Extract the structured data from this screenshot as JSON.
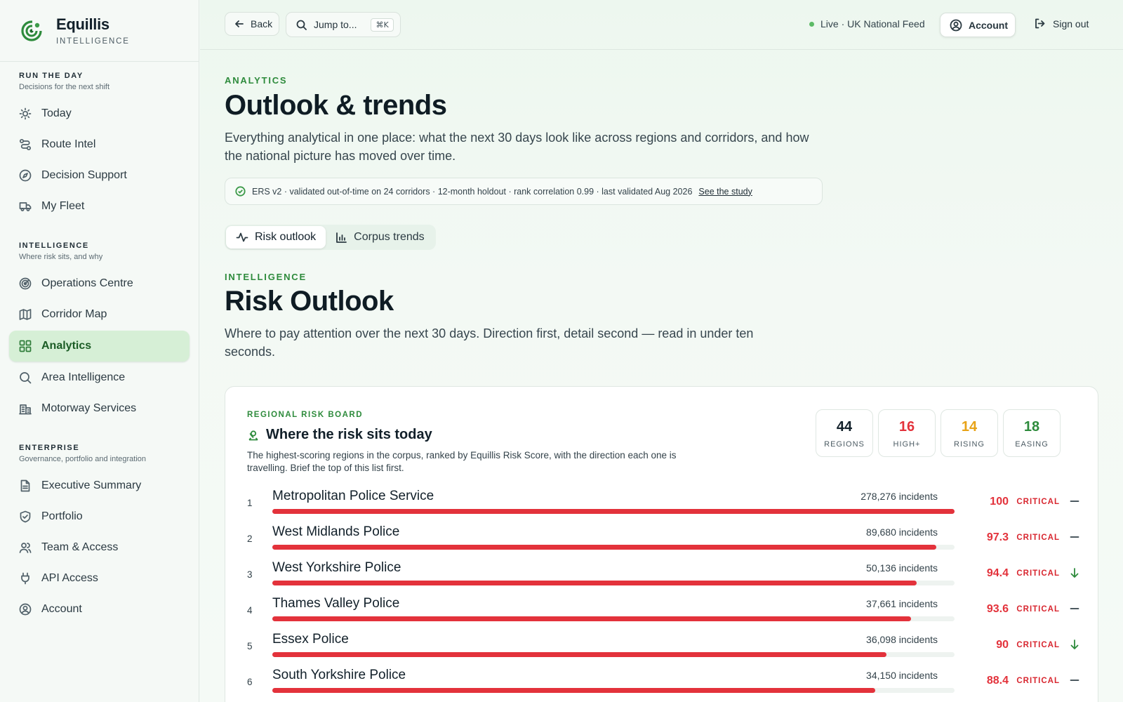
{
  "brand": {
    "name": "Equillis",
    "sub": "INTELLIGENCE"
  },
  "sidebar": {
    "sections": [
      {
        "title": "RUN THE DAY",
        "desc": "Decisions for the next shift",
        "items": [
          {
            "label": "Today",
            "icon": "sun-icon"
          },
          {
            "label": "Route Intel",
            "icon": "route-icon"
          },
          {
            "label": "Decision Support",
            "icon": "compass-icon"
          },
          {
            "label": "My Fleet",
            "icon": "truck-icon"
          }
        ]
      },
      {
        "title": "INTELLIGENCE",
        "desc": "Where risk sits, and why",
        "items": [
          {
            "label": "Operations Centre",
            "icon": "radar-icon"
          },
          {
            "label": "Corridor Map",
            "icon": "map-icon"
          },
          {
            "label": "Analytics",
            "icon": "grid-icon",
            "active": true
          },
          {
            "label": "Area Intelligence",
            "icon": "search-icon"
          },
          {
            "label": "Motorway Services",
            "icon": "building-icon"
          }
        ]
      },
      {
        "title": "ENTERPRISE",
        "desc": "Governance, portfolio and integration",
        "items": [
          {
            "label": "Executive Summary",
            "icon": "document-icon"
          },
          {
            "label": "Portfolio",
            "icon": "shield-icon"
          },
          {
            "label": "Team & Access",
            "icon": "users-icon"
          },
          {
            "label": "API Access",
            "icon": "plug-icon"
          },
          {
            "label": "Account",
            "icon": "user-circle-icon"
          }
        ]
      }
    ]
  },
  "topbar": {
    "back_label": "Back",
    "jump_label": "Jump to...",
    "jump_shortcut": "⌘K",
    "live_label": "Live · UK National Feed",
    "account_label": "Account",
    "signout_label": "Sign out"
  },
  "page": {
    "eyebrow": "ANALYTICS",
    "title": "Outlook & trends",
    "lead": "Everything analytical in one place: what the next 30 days look like across regions and corridors, and how the national picture has moved over time.",
    "validation_text": "ERS v2 · validated out-of-time on 24 corridors · 12-month holdout · rank correlation 0.99 · last validated Aug 2026",
    "validation_link": "See the study",
    "tabs": [
      {
        "label": "Risk outlook",
        "icon": "pulse-icon",
        "active": true
      },
      {
        "label": "Corpus trends",
        "icon": "bar-chart-icon"
      }
    ]
  },
  "section": {
    "eyebrow": "INTELLIGENCE",
    "title": "Risk Outlook",
    "lead": "Where to pay attention over the next 30 days. Direction first, detail second — read in under ten seconds."
  },
  "board": {
    "eyebrow": "REGIONAL RISK BOARD",
    "title": "Where the risk sits today",
    "desc": "The highest-scoring regions in the corpus, ranked by Equillis Risk Score, with the direction each one is travelling. Brief the top of this list first.",
    "stats": [
      {
        "value": "44",
        "label": "REGIONS",
        "color": "#12202a"
      },
      {
        "value": "16",
        "label": "HIGH+",
        "color": "#e3323b"
      },
      {
        "value": "14",
        "label": "RISING",
        "color": "#e8a317"
      },
      {
        "value": "18",
        "label": "EASING",
        "color": "#2e8b3c"
      }
    ],
    "rows": [
      {
        "rank": "1",
        "name": "Metropolitan Police Service",
        "incidents": "278,276 incidents",
        "score": "100",
        "score_value": 100,
        "level": "CRITICAL",
        "trend": "flat"
      },
      {
        "rank": "2",
        "name": "West Midlands Police",
        "incidents": "89,680 incidents",
        "score": "97.3",
        "score_value": 97.3,
        "level": "CRITICAL",
        "trend": "flat"
      },
      {
        "rank": "3",
        "name": "West Yorkshire Police",
        "incidents": "50,136 incidents",
        "score": "94.4",
        "score_value": 94.4,
        "level": "CRITICAL",
        "trend": "down"
      },
      {
        "rank": "4",
        "name": "Thames Valley Police",
        "incidents": "37,661 incidents",
        "score": "93.6",
        "score_value": 93.6,
        "level": "CRITICAL",
        "trend": "flat"
      },
      {
        "rank": "5",
        "name": "Essex Police",
        "incidents": "36,098 incidents",
        "score": "90",
        "score_value": 90,
        "level": "CRITICAL",
        "trend": "down"
      },
      {
        "rank": "6",
        "name": "South Yorkshire Police",
        "incidents": "34,150 incidents",
        "score": "88.4",
        "score_value": 88.4,
        "level": "CRITICAL",
        "trend": "flat"
      }
    ]
  }
}
